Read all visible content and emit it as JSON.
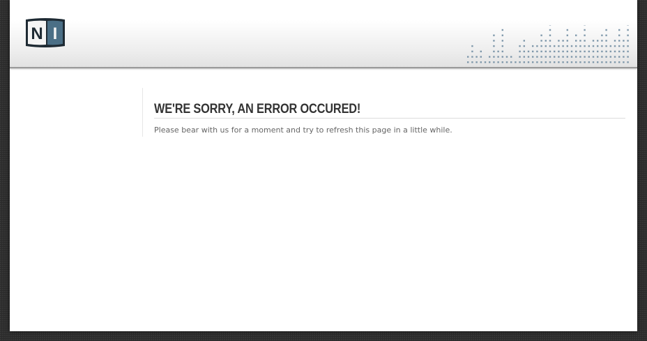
{
  "header": {
    "logo_text_left": "N",
    "logo_text_right": "I",
    "logo_icon": "native-instruments-logo-icon",
    "decoration_icon": "equalizer-bars-icon"
  },
  "error": {
    "title": "WE'RE SORRY, AN ERROR OCCURED!",
    "message": "Please bear with us for a moment and try to refresh this page in a little while."
  },
  "colors": {
    "background": "#2b2b2b",
    "page": "#ffffff",
    "title": "#333333",
    "message": "#666666",
    "equalizer": "#7f98ab",
    "logo_dark": "#1e2a33",
    "logo_blue": "#4b6f86"
  }
}
